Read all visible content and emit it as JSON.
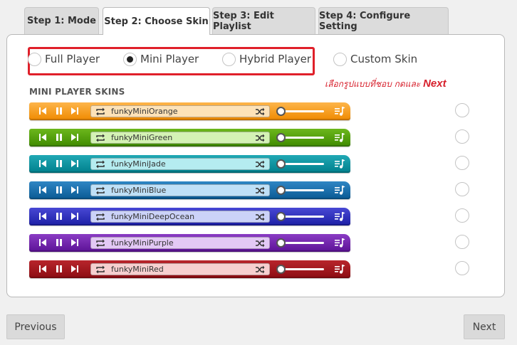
{
  "tabs": [
    {
      "label": "Step 1: Mode",
      "active": false
    },
    {
      "label": "Step 2: Choose Skin",
      "active": true
    },
    {
      "label": "Step 3: Edit Playlist",
      "active": false
    },
    {
      "label": "Step 4: Configure Setting",
      "active": false
    }
  ],
  "player_options": [
    {
      "label": "Full Player",
      "selected": false
    },
    {
      "label": "Mini Player",
      "selected": true
    },
    {
      "label": "Hybrid Player",
      "selected": false
    },
    {
      "label": "Custom Skin",
      "selected": false
    }
  ],
  "annotation": {
    "text": "เลือกรูปแบบที่ชอบ กดและ ",
    "emphasis": "Next",
    "highlight_color": "#e0202a"
  },
  "section_title": "MINI PLAYER SKINS",
  "skins": [
    {
      "name": "funkyMiniOrange",
      "color": "#f08a00",
      "color_light": "#fdb54a",
      "track_bg": "#fde2b8",
      "selected": false
    },
    {
      "name": "funkyMiniGreen",
      "color": "#3f8a00",
      "color_light": "#6cb71c",
      "track_bg": "#d4f2b5",
      "selected": false
    },
    {
      "name": "funkyMiniJade",
      "color": "#007f8c",
      "color_light": "#21a9b5",
      "track_bg": "#b5ecf0",
      "selected": false
    },
    {
      "name": "funkyMiniBlue",
      "color": "#0a5a94",
      "color_light": "#2f86c4",
      "track_bg": "#bfe0f7",
      "selected": false
    },
    {
      "name": "funkyMiniDeepOcean",
      "color": "#1c1fa6",
      "color_light": "#4848d4",
      "track_bg": "#cbd2f8",
      "selected": false
    },
    {
      "name": "funkyMiniPurple",
      "color": "#5c1296",
      "color_light": "#8a3cc4",
      "track_bg": "#e3c9f5",
      "selected": false
    },
    {
      "name": "funkyMiniRed",
      "color": "#8c0c12",
      "color_light": "#b8262c",
      "track_bg": "#f6cfcf",
      "selected": false
    }
  ],
  "icons": {
    "prev": "skip-back-icon",
    "pause": "pause-icon",
    "next": "skip-forward-icon",
    "repeat": "repeat-icon",
    "shuffle": "shuffle-icon",
    "volume": "volume-slider",
    "playlist": "playlist-icon"
  },
  "buttons": {
    "previous": "Previous",
    "next": "Next"
  }
}
